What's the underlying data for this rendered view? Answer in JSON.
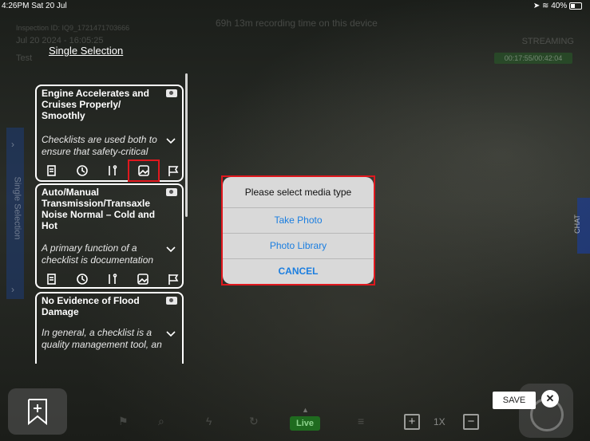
{
  "status_bar": {
    "time_date": "4:26PM  Sat 20 Jul",
    "battery": "40%"
  },
  "background_info": {
    "recording_time": "69h 13m recording time on this device",
    "inspection_id": "Inspection ID: IQ9_1721471703666",
    "date": "Jul 20 2024 - 16:05:25",
    "test_label": "Test",
    "streaming": "STREAMING",
    "stream_time": "00:17:55/00:42:04"
  },
  "header": {
    "single_selection_link": "Single Selection"
  },
  "side_tabs": {
    "left_label": "Single Selection",
    "right_label": "CHAT"
  },
  "cards": [
    {
      "title": "Engine Accelerates and Cruises Properly/ Smoothly",
      "desc": "Checklists are used both to ensure that safety-critical"
    },
    {
      "title": "Auto/Manual Transmission/Transaxle Noise Normal – Cold and Hot",
      "desc": "A primary function of a checklist is documentation"
    },
    {
      "title": "No Evidence of Flood Damage",
      "desc": "In general, a checklist is a quality management tool, an"
    }
  ],
  "card_tools": [
    "document-icon",
    "history-icon",
    "tools-icon",
    "image-icon",
    "flag-icon"
  ],
  "media_dialog": {
    "title": "Please select media type",
    "take_photo": "Take Photo",
    "photo_library": "Photo Library",
    "cancel": "CANCEL"
  },
  "bottom_bar": {
    "live": "Live",
    "zoom": "1X",
    "save": "SAVE",
    "close": "✕"
  },
  "colors": {
    "highlight_red": "#e0181e",
    "link_blue": "#1b7ee0",
    "live_green": "#1f6b1f"
  }
}
